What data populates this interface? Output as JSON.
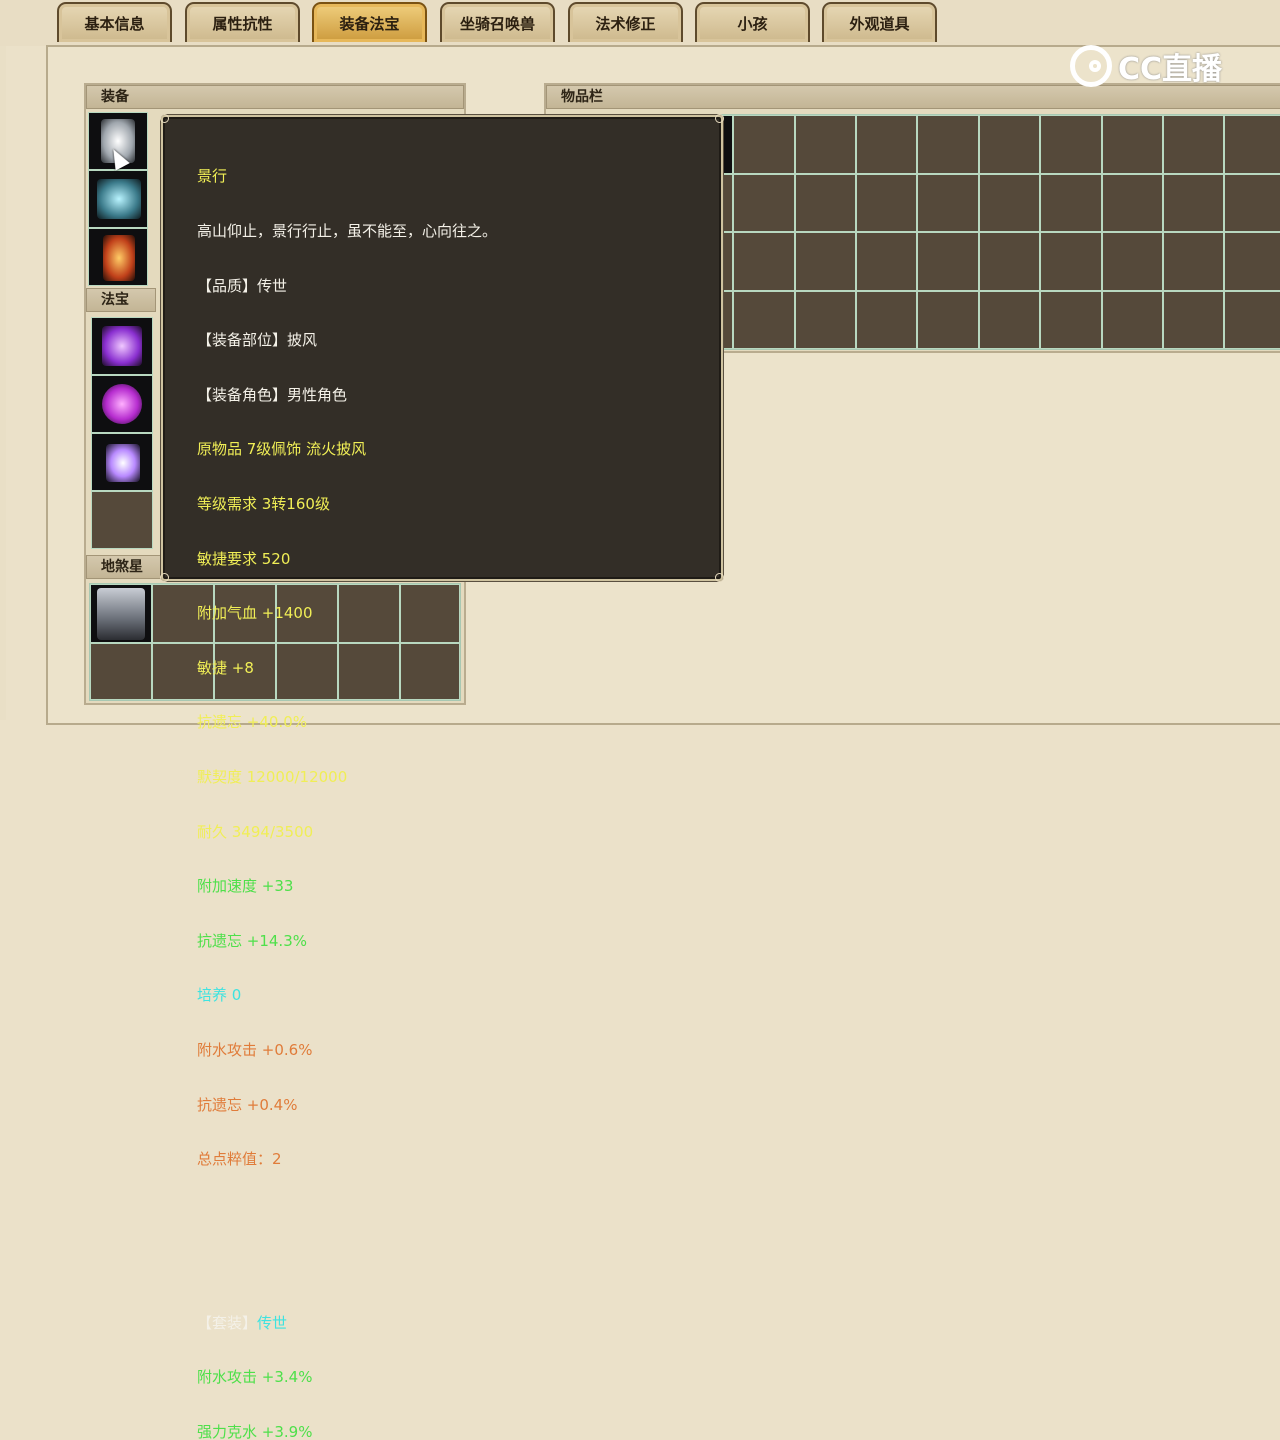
{
  "tabs": [
    "基本信息",
    "属性抗性",
    "装备法宝",
    "坐骑召唤兽",
    "法术修正",
    "小孩",
    "外观道具"
  ],
  "active_tab": "装备法宝",
  "watermark": "CC直播",
  "panels": {
    "equipment": "装备",
    "treasure": "法宝",
    "star": "地煞星",
    "inventory": "物品栏"
  },
  "tooltip": {
    "name": "景行",
    "desc": "高山仰止，景行行止，虽不能至，心向往之。",
    "quality": "【品质】传世",
    "slot": "【装备部位】披风",
    "role": "【装备角色】男性角色",
    "original": "原物品 7级佩饰 流火披风",
    "level_req": "等级需求 3转160级",
    "agility_req": "敏捷要求 520",
    "hp": "附加气血 +1400",
    "agility": "敏捷 +8",
    "resist": "抗遗忘 +40.0%",
    "tacit": "默契度 12000/12000",
    "durability": "耐久 3494/3500",
    "speed": "附加速度 +33",
    "resist2": "抗遗忘 +14.3%",
    "cultivate": "培养 0",
    "water_atk": "附水攻击 +0.6%",
    "resist3": "抗遗忘 +0.4%",
    "purity": "总点粹值：2",
    "set_label": "【套装】",
    "set_name": "传世",
    "set_water": "附水攻击 +3.4%",
    "set_counter": "强力克水 +3.9%"
  }
}
